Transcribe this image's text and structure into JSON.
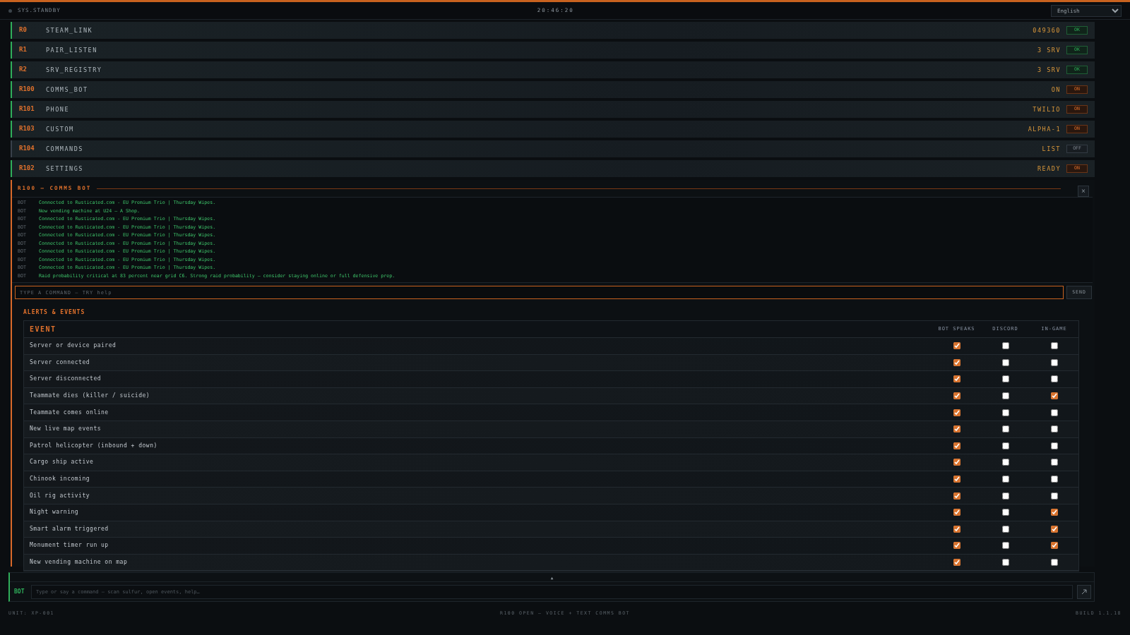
{
  "top_bar": {
    "status": "SYS.STANDBY",
    "clock": "20:46:20",
    "language": "English"
  },
  "modules": [
    {
      "code": "R0",
      "name": "STEAM_LINK",
      "value": "049360",
      "badge": "OK",
      "kind": "ok",
      "active": true
    },
    {
      "code": "R1",
      "name": "PAIR_LISTEN",
      "value": "3 SRV",
      "badge": "OK",
      "kind": "ok",
      "active": true
    },
    {
      "code": "R2",
      "name": "SRV_REGISTRY",
      "value": "3 SRV",
      "badge": "OK",
      "kind": "ok",
      "active": true
    },
    {
      "code": "R100",
      "name": "COMMS_BOT",
      "value": "ON",
      "badge": "ON",
      "kind": "on",
      "active": true
    },
    {
      "code": "R101",
      "name": "PHONE",
      "value": "TWILIO",
      "badge": "ON",
      "kind": "on",
      "active": true
    },
    {
      "code": "R103",
      "name": "CUSTOM",
      "value": "ALPHA-1",
      "badge": "ON",
      "kind": "on",
      "active": true
    },
    {
      "code": "R104",
      "name": "COMMANDS",
      "value": "LIST",
      "badge": "OFF",
      "kind": "off",
      "active": false
    },
    {
      "code": "R102",
      "name": "SETTINGS",
      "value": "READY",
      "badge": "ON",
      "kind": "on",
      "active": true
    }
  ],
  "comms_panel": {
    "title": "R100 — COMMS BOT",
    "close": "×",
    "log": [
      {
        "source": "BOT",
        "message": "Connected to Rusticated.com - EU Premium Trio | Thursday Wipes."
      },
      {
        "source": "BOT",
        "message": "New vending machine at U24 — A Shop."
      },
      {
        "source": "BOT",
        "message": "Connected to Rusticated.com - EU Premium Trio | Thursday Wipes."
      },
      {
        "source": "BOT",
        "message": "Connected to Rusticated.com - EU Premium Trio | Thursday Wipes."
      },
      {
        "source": "BOT",
        "message": "Connected to Rusticated.com - EU Premium Trio | Thursday Wipes."
      },
      {
        "source": "BOT",
        "message": "Connected to Rusticated.com - EU Premium Trio | Thursday Wipes."
      },
      {
        "source": "BOT",
        "message": "Connected to Rusticated.com - EU Premium Trio | Thursday Wipes."
      },
      {
        "source": "BOT",
        "message": "Connected to Rusticated.com - EU Premium Trio | Thursday Wipes."
      },
      {
        "source": "BOT",
        "message": "Connected to Rusticated.com - EU Premium Trio | Thursday Wipes."
      },
      {
        "source": "BOT",
        "message": "Raid probability critical at 83 percent near grid C6. Strong raid probability — consider staying online or full defensive prep."
      }
    ],
    "command": {
      "placeholder": "TYPE A COMMAND — TRY help"
    },
    "send": "SEND"
  },
  "alerts": {
    "title": "ALERTS & EVENTS",
    "columns": [
      "EVENT",
      "BOT SPEAKS",
      "DISCORD",
      "IN-GAME"
    ],
    "rows": [
      {
        "event": "Server or device paired",
        "bot_speaks": true,
        "discord": false,
        "in_game": false
      },
      {
        "event": "Server connected",
        "bot_speaks": true,
        "discord": false,
        "in_game": false
      },
      {
        "event": "Server disconnected",
        "bot_speaks": true,
        "discord": false,
        "in_game": false
      },
      {
        "event": "Teammate dies (killer / suicide)",
        "bot_speaks": true,
        "discord": false,
        "in_game": true
      },
      {
        "event": "Teammate comes online",
        "bot_speaks": true,
        "discord": false,
        "in_game": false
      },
      {
        "event": "New live map events",
        "bot_speaks": true,
        "discord": false,
        "in_game": false
      },
      {
        "event": "Patrol helicopter (inbound + down)",
        "bot_speaks": true,
        "discord": false,
        "in_game": false
      },
      {
        "event": "Cargo ship active",
        "bot_speaks": true,
        "discord": false,
        "in_game": false
      },
      {
        "event": "Chinook incoming",
        "bot_speaks": true,
        "discord": false,
        "in_game": false
      },
      {
        "event": "Oil rig activity",
        "bot_speaks": true,
        "discord": false,
        "in_game": false
      },
      {
        "event": "Night warning",
        "bot_speaks": true,
        "discord": false,
        "in_game": true
      },
      {
        "event": "Smart alarm triggered",
        "bot_speaks": true,
        "discord": false,
        "in_game": true
      },
      {
        "event": "Monument timer run up",
        "bot_speaks": true,
        "discord": false,
        "in_game": true
      },
      {
        "event": "New vending machine on map",
        "bot_speaks": true,
        "discord": false,
        "in_game": false
      }
    ]
  },
  "bot_bar": {
    "expand": "▲",
    "label": "BOT",
    "placeholder": "Type or say a command — scan sulfur, open events, help…"
  },
  "footer": {
    "unit": "UNIT: XP-001",
    "mode": "R100 OPEN — VOICE + TEXT COMMS BOT",
    "build": "BUILD 1.1.18"
  }
}
